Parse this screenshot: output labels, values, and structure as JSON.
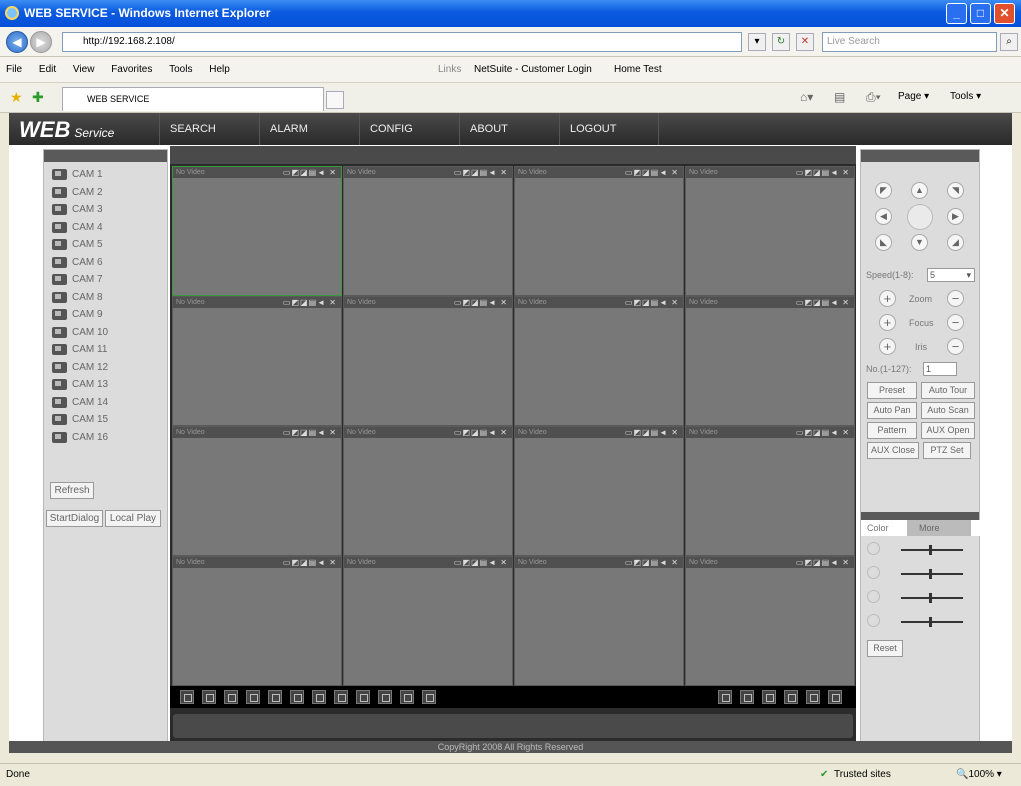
{
  "browser": {
    "title": "WEB SERVICE - Windows Internet Explorer",
    "address": "http://192.168.2.108/",
    "search_placeholder": "Live Search",
    "menu": [
      "File",
      "Edit",
      "View",
      "Favorites",
      "Tools",
      "Help"
    ],
    "links_label": "Links",
    "link_items": [
      "NetSuite - Customer Login",
      "Home Test"
    ],
    "tab_title": "WEB SERVICE",
    "cmd_page": "Page",
    "cmd_tools": "Tools",
    "status_left": "Done",
    "zone": "Trusted sites",
    "zoom": "100%"
  },
  "app": {
    "logo_main": "WEB",
    "logo_sub": "Service",
    "nav": [
      "SEARCH",
      "ALARM",
      "CONFIG",
      "ABOUT",
      "LOGOUT"
    ],
    "cameras": [
      "CAM 1",
      "CAM 2",
      "CAM 3",
      "CAM 4",
      "CAM 5",
      "CAM 6",
      "CAM 7",
      "CAM 8",
      "CAM 9",
      "CAM 10",
      "CAM 11",
      "CAM 12",
      "CAM 13",
      "CAM 14",
      "CAM 15",
      "CAM 16"
    ],
    "refresh": "Refresh",
    "start_dialog": "StartDialog",
    "local_play": "Local Play",
    "no_video": "No Video",
    "tile_icons": "▭◩◪▤◄ ✕",
    "footer": "CopyRight 2008 All Rights Reserved"
  },
  "ptz": {
    "speed_label": "Speed(1-8):",
    "speed_value": "5",
    "zoom": "Zoom",
    "focus": "Focus",
    "iris": "Iris",
    "no_label": "No.(1-127):",
    "no_value": "1",
    "buttons": [
      "Preset",
      "Auto Tour",
      "Auto Pan",
      "Auto Scan",
      "Pattern",
      "AUX Open",
      "AUX Close",
      "PTZ Set"
    ],
    "tabs": [
      "Color",
      "More"
    ],
    "reset": "Reset"
  }
}
